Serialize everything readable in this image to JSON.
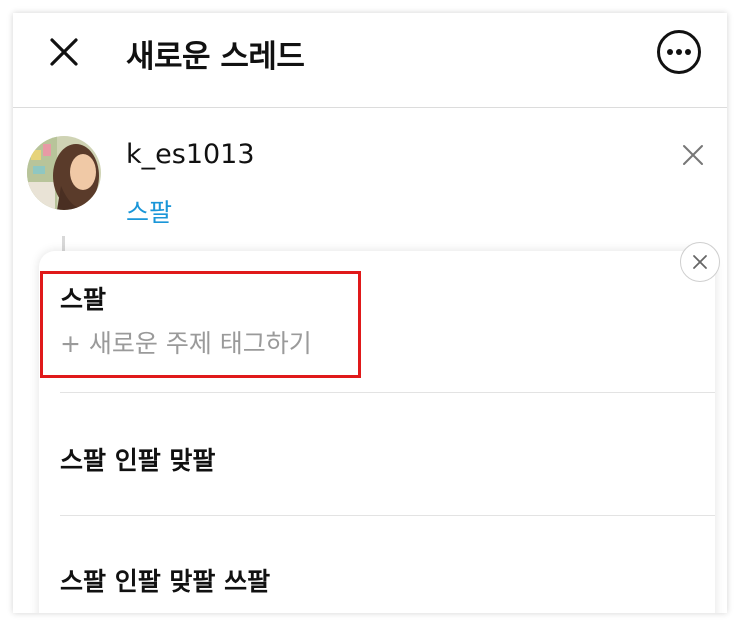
{
  "header": {
    "title": "새로운 스레드"
  },
  "post": {
    "username": "k_es1013",
    "topic": "스팔"
  },
  "suggestions": {
    "first_title": "스팔",
    "new_topic_label": "+ 새로운 주제 태그하기",
    "items": [
      {
        "label": "스팔 인팔 맞팔"
      },
      {
        "label": "스팔 인팔 맞팔 쓰팔"
      }
    ]
  },
  "colors": {
    "accent_link": "#1a96d8",
    "highlight_box": "#e0191a",
    "placeholder_gray": "#9a9a9a"
  },
  "icons": {
    "close": "close-icon",
    "more": "more-options-icon",
    "avatar": "profile-avatar"
  }
}
